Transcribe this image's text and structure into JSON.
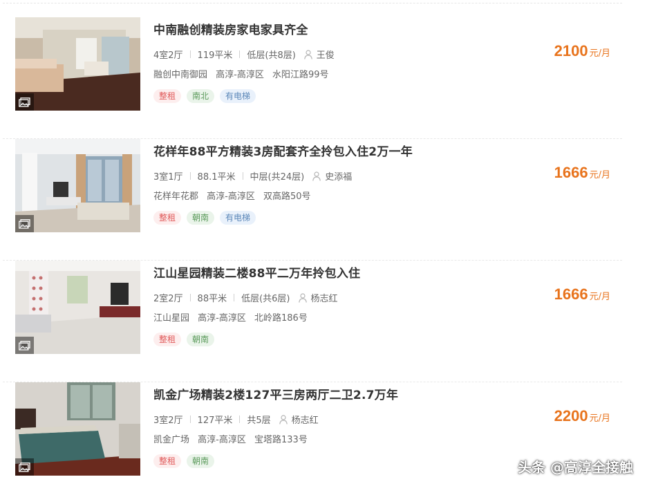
{
  "listings": [
    {
      "title": "中南融创精装房家电家具齐全",
      "layout": "4室2厅",
      "area": "119平米",
      "floor": "低层(共8层)",
      "agent": "王俊",
      "community": "融创中南御园",
      "district": "高淳-高淳区",
      "street": "水阳江路99号",
      "tags": [
        "整租",
        "南北",
        "有电梯"
      ],
      "price": "2100",
      "price_unit": "元/月"
    },
    {
      "title": "花样年88平方精装3房配套齐全拎包入住2万一年",
      "layout": "3室1厅",
      "area": "88.1平米",
      "floor": "中层(共24层)",
      "agent": "史添福",
      "community": "花样年花郡",
      "district": "高淳-高淳区",
      "street": "双高路50号",
      "tags": [
        "整租",
        "朝南",
        "有电梯"
      ],
      "price": "1666",
      "price_unit": "元/月"
    },
    {
      "title": "江山星园精装二楼88平二万年拎包入住",
      "layout": "2室2厅",
      "area": "88平米",
      "floor": "低层(共6层)",
      "agent": "杨志红",
      "community": "江山星园",
      "district": "高淳-高淳区",
      "street": "北岭路186号",
      "tags": [
        "整租",
        "朝南"
      ],
      "price": "1666",
      "price_unit": "元/月"
    },
    {
      "title": "凯金广场精装2楼127平三房两厅二卫2.7万年",
      "layout": "3室2厅",
      "area": "127平米",
      "floor": "共5层",
      "agent": "杨志红",
      "community": "凯金广场",
      "district": "高淳-高淳区",
      "street": "宝塔路133号",
      "tags": [
        "整租",
        "朝南"
      ],
      "price": "2200",
      "price_unit": "元/月"
    }
  ],
  "watermark": "头条 @高淳全接触",
  "colors": {
    "price": "#e8731c",
    "tag_rent": "#e05a5a",
    "tag_orientation": "#5b9a5b",
    "tag_elevator": "#5b87b8"
  },
  "icons": {
    "gallery": "image-gallery-icon",
    "agent": "person-icon"
  }
}
